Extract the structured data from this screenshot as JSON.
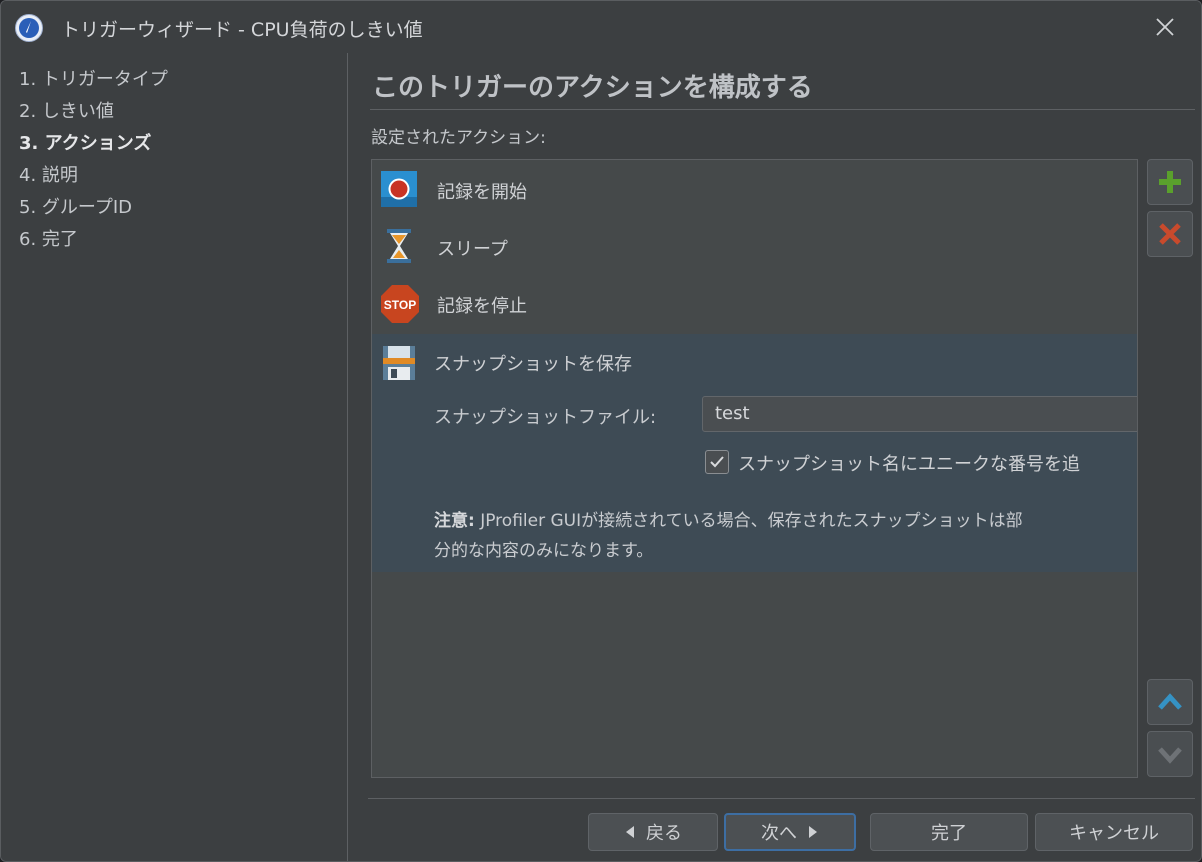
{
  "window": {
    "title": "トリガーウィザード - CPU負荷のしきい値"
  },
  "steps": [
    {
      "label": "1. トリガータイプ",
      "active": false
    },
    {
      "label": "2. しきい値",
      "active": false
    },
    {
      "label": "3. アクションズ",
      "active": true
    },
    {
      "label": "4. 説明",
      "active": false
    },
    {
      "label": "5. グループID",
      "active": false
    },
    {
      "label": "6. 完了",
      "active": false
    }
  ],
  "main": {
    "heading": "このトリガーのアクションを構成する",
    "configured_label": "設定されたアクション:",
    "actions": [
      {
        "label": "記録を開始",
        "icon": "record-start-icon"
      },
      {
        "label": "スリープ",
        "icon": "hourglass-icon"
      },
      {
        "label": "記録を停止",
        "icon": "stop-sign-icon"
      },
      {
        "label": "スナップショットを保存",
        "icon": "floppy-disk-icon",
        "selected": true
      }
    ],
    "snapshot": {
      "file_label": "スナップショットファイル:",
      "file_value": "test",
      "unique_checkbox_label": "スナップショット名にユニークな番号を追",
      "unique_checked": true,
      "note_bold": "注意:",
      "note_line1": " JProfiler GUIが接続されている場合、保存されたスナップショットは部",
      "note_line2": "分的な内容のみになります。"
    }
  },
  "buttons": {
    "back": "戻る",
    "next": "次へ",
    "finish": "完了",
    "cancel": "キャンセル"
  },
  "colors": {
    "add_icon": "#5aa02c",
    "remove_icon": "#c84a2c",
    "up_icon": "#3592c4",
    "primary_border": "#3d6ea3"
  }
}
